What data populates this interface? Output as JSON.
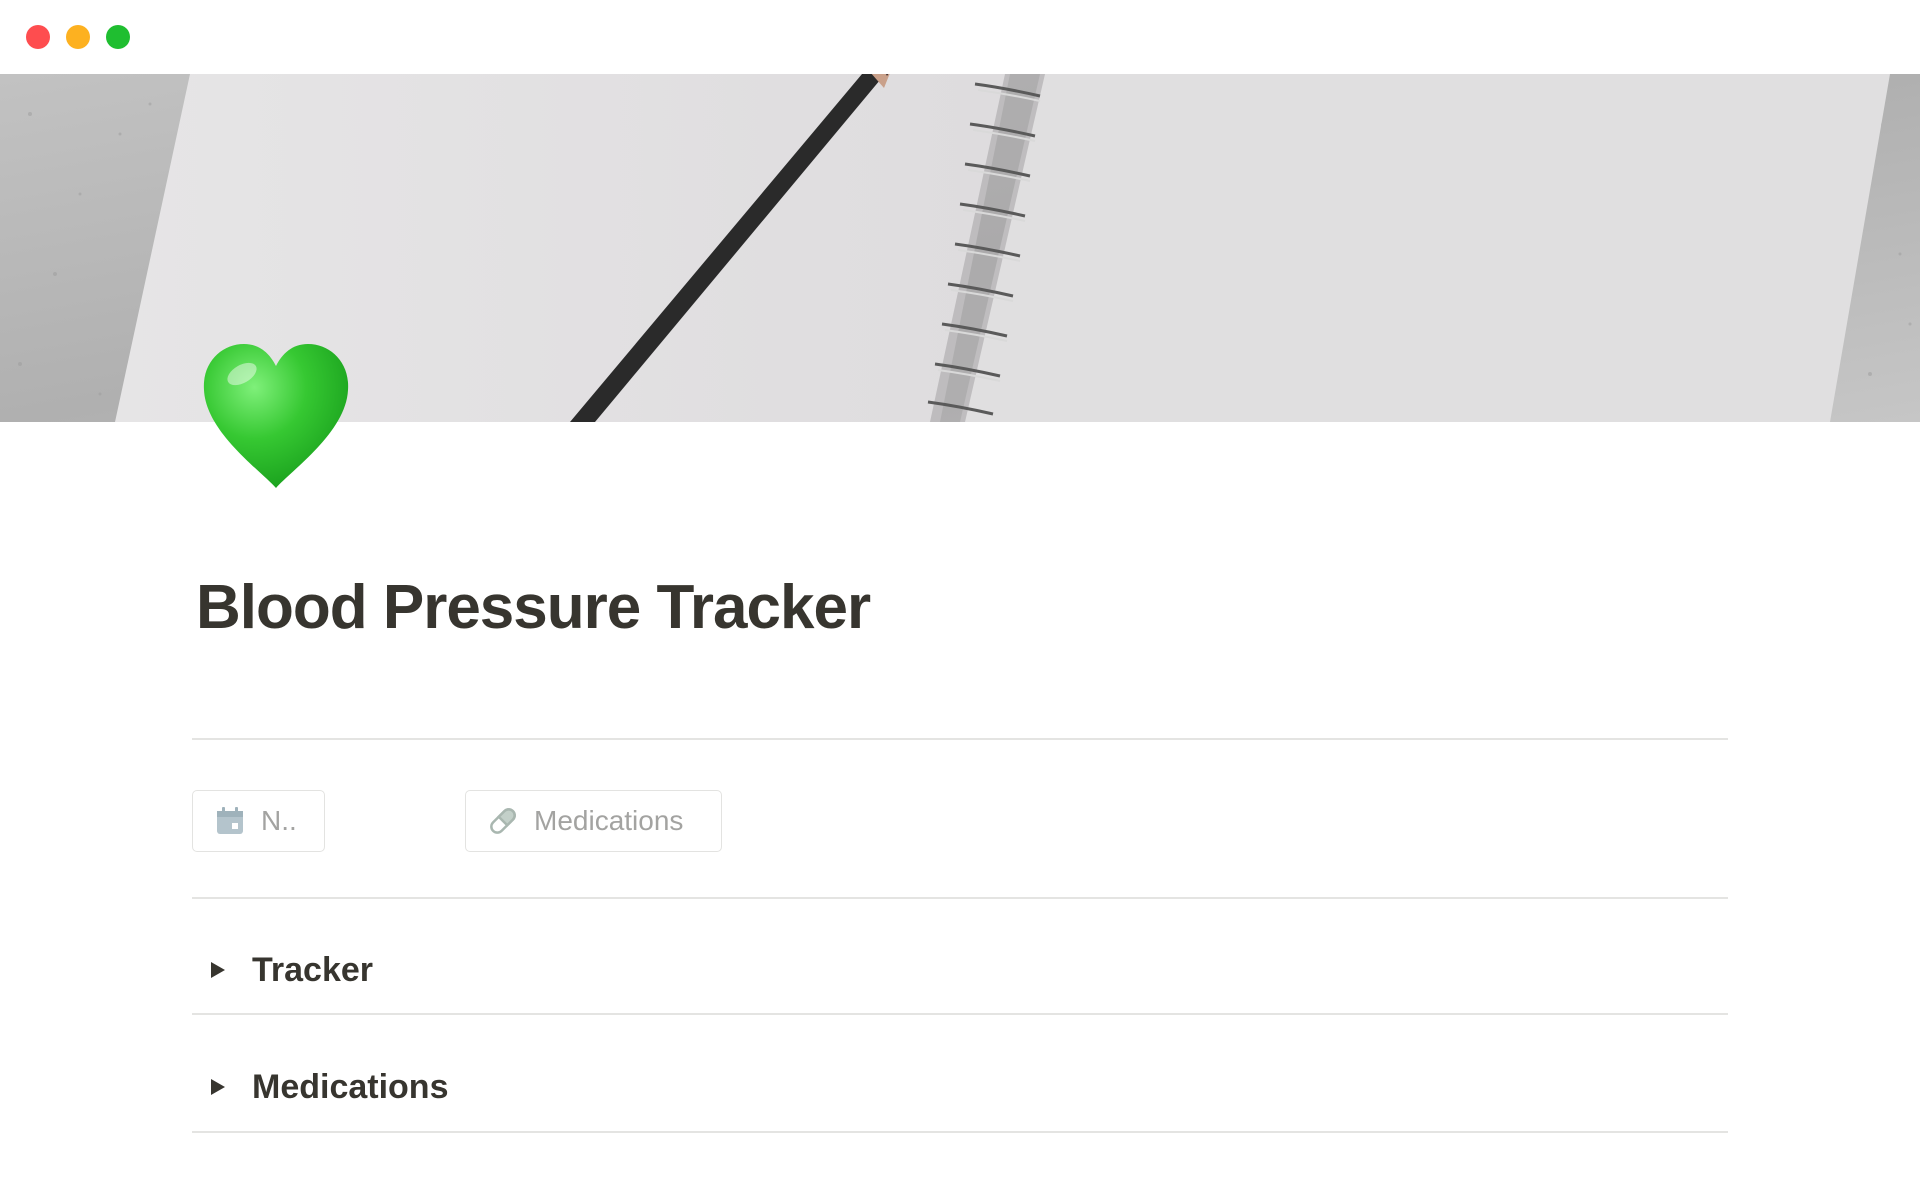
{
  "window": {
    "controls": [
      "close",
      "minimize",
      "maximize"
    ]
  },
  "cover": {
    "description_icon": "notebook-pencil-cover"
  },
  "page": {
    "icon": "green-heart-icon",
    "title": "Blood Pressure Tracker"
  },
  "buttons": [
    {
      "label": "N..",
      "icon": "calendar-icon"
    },
    {
      "label": "Medications",
      "icon": "pill-icon"
    }
  ],
  "toggles": [
    {
      "label": "Tracker"
    },
    {
      "label": "Medications"
    }
  ],
  "colors": {
    "text": "#37352f",
    "muted": "#a3a3a1",
    "divider": "#e4e4e2",
    "heart": "#2ec02e",
    "close": "#fe4d4f",
    "minimize": "#fdb120",
    "maximize": "#1fbe30"
  }
}
